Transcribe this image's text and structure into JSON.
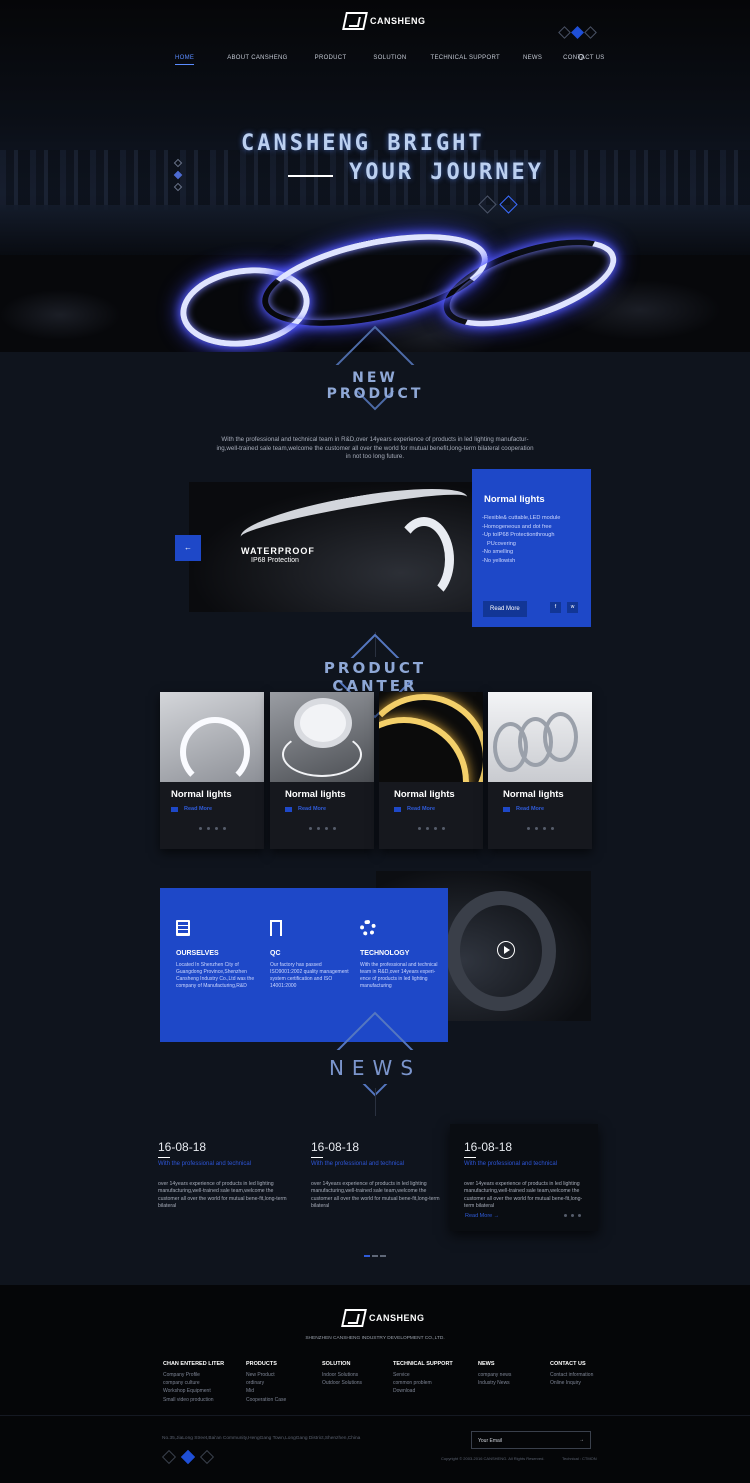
{
  "header": {
    "brand": "CANSHENG",
    "nav": [
      "HOME",
      "ABOUT CANSHENG",
      "PRODUCT",
      "SOLUTION",
      "TECHNICAL SUPPORT",
      "NEWS",
      "CONTACT US"
    ],
    "search_icon": "search-icon",
    "social_icons": [
      "weibo-icon",
      "facebook-icon",
      "wechat-icon"
    ]
  },
  "hero": {
    "title_line1": "CANSHENG BRIGHT",
    "title_line2": "YOUR JOURNEY"
  },
  "new_product": {
    "title": "NEW PRODUCT",
    "intro_1": "With the professional and technical team in R&D,over 14years experience of products in led lighting manufactur-",
    "intro_2": "ing,well-trained sale team,welcome the customer all over the world for mutual benefit,long-term bilateral cooperation",
    "intro_3": "in not too long future.",
    "slide": {
      "image_text_1": "WATERPROOF",
      "image_text_2": "IP68 Protection",
      "prev_icon": "←",
      "heading": "Normal lights",
      "features": [
        "-Flexible& cuttable,LED module",
        "-Homogeneous and dot free",
        "-Up toIP68 Protectionthrough",
        "  PUcovering",
        "-No smelling",
        "-No yellowish"
      ],
      "read_more": "Read More",
      "icon_1": "f",
      "icon_2": "w"
    }
  },
  "product_center": {
    "title": "PRODUCT CANTER",
    "cards": [
      {
        "name": "Normal lights",
        "more": "Read More"
      },
      {
        "name": "Normal lights",
        "more": "Read More"
      },
      {
        "name": "Normal lights",
        "more": "Read More"
      },
      {
        "name": "Normal lights",
        "more": "Read More"
      }
    ]
  },
  "about": {
    "items": [
      {
        "heading": "OURSELVES",
        "text": "Located In Shenzhen City of Guangdong Province,Shenzhen Cansheng Industry Co.,Ltd was the company of Manufacturing,R&D"
      },
      {
        "heading": "QC",
        "text": "Our factory has passed ISO9001:2002 quality management system certification and ISO 14001:2000"
      },
      {
        "heading": "TECHNOLOGY",
        "text": "With the professional and technical team in R&D,over 14years experi-ence of products in led lighting manufacturing"
      }
    ]
  },
  "news": {
    "title": "NEWS",
    "items": [
      {
        "date": "16-08-18",
        "subtitle": "With the professional and technical",
        "text": "over 14years experience of products in led lighting manufacturing,well-trained sale team,welcome the customer all over the world for mutual bene-fit,long-term bilateral"
      },
      {
        "date": "16-08-18",
        "subtitle": "With the professional and technical",
        "text": "over 14years experience of products in led lighting manufacturing,well-trained sale team,welcome the customer all over the world for mutual bene-fit,long-term bilateral"
      },
      {
        "date": "16-08-18",
        "subtitle": "With the professional and technical",
        "text": "over 14years experience of products in led lighting manufacturing,well-trained sale team,welcome the customer all over the world for mutual bene-fit,long-term bilateral",
        "more": "Read More"
      }
    ]
  },
  "footer": {
    "brand": "CANSHENG",
    "company": "SHENZHEN CANSHENG INDUSTRY DEVELOPMENT CO.,LTD.",
    "columns": [
      {
        "title": "CHAN ENTERED LITER",
        "items": [
          "Company Profile",
          "company culture",
          "Workshop Equipment",
          "Small video production"
        ]
      },
      {
        "title": "PRODUCTS",
        "items": [
          "New Product",
          "ordinary",
          "Mid",
          "Cooperation Case"
        ]
      },
      {
        "title": "SOLUTION",
        "items": [
          "Indoor Solutions",
          "Outdoor Solutions"
        ]
      },
      {
        "title": "TECHNICAL SUPPORT",
        "items": [
          "Service",
          "common problem",
          "Download"
        ]
      },
      {
        "title": "NEWS",
        "items": [
          "company news",
          "Industry News"
        ]
      },
      {
        "title": "CONTACT US",
        "items": [
          "Contact information",
          "Online Inquiry"
        ]
      }
    ],
    "address": "No.35,JiaLong Street,Bai'an Community,HengGang Town,LongGang District,Shenzhen,China",
    "email_placeholder": "Your Email",
    "email_arrow": "→",
    "copyright": "Copyright © 2003-2016 CANSHENG. All Rights Reserved.",
    "links": "Technical : CTMON"
  }
}
